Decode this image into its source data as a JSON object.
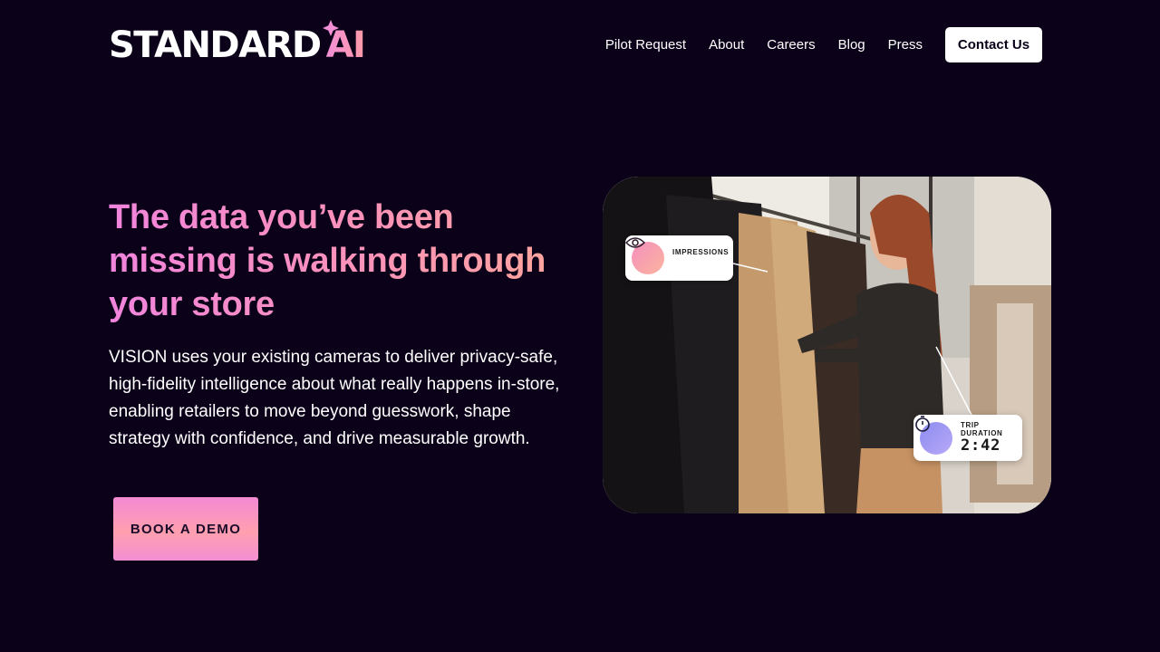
{
  "brand": {
    "logo_word": "STANDARD",
    "logo_ai": "AI"
  },
  "nav": {
    "items": [
      {
        "label": "Pilot Request"
      },
      {
        "label": "About"
      },
      {
        "label": "Careers"
      },
      {
        "label": "Blog"
      },
      {
        "label": "Press"
      }
    ],
    "contact_label": "Contact Us"
  },
  "hero": {
    "headline": "The data you’ve been missing is walking through your store",
    "lede": "VISION uses your existing cameras to deliver privacy-safe, high-fidelity intelligence about what really happens in-store, enabling retailers to move beyond guesswork, shape strategy with confidence, and drive measurable growth.",
    "cta_label": "BOOK A DEMO"
  },
  "overlay": {
    "impressions_label": "IMPRESSIONS",
    "impressions_icon": "eye-icon",
    "trip_label_line1": "TRIP",
    "trip_label_line2": "DURATION",
    "trip_value": "2:42",
    "trip_icon": "stopwatch-icon"
  },
  "colors": {
    "background": "#0b021a",
    "accent_pink": "#f184dc",
    "accent_peach": "#ffa79a"
  }
}
